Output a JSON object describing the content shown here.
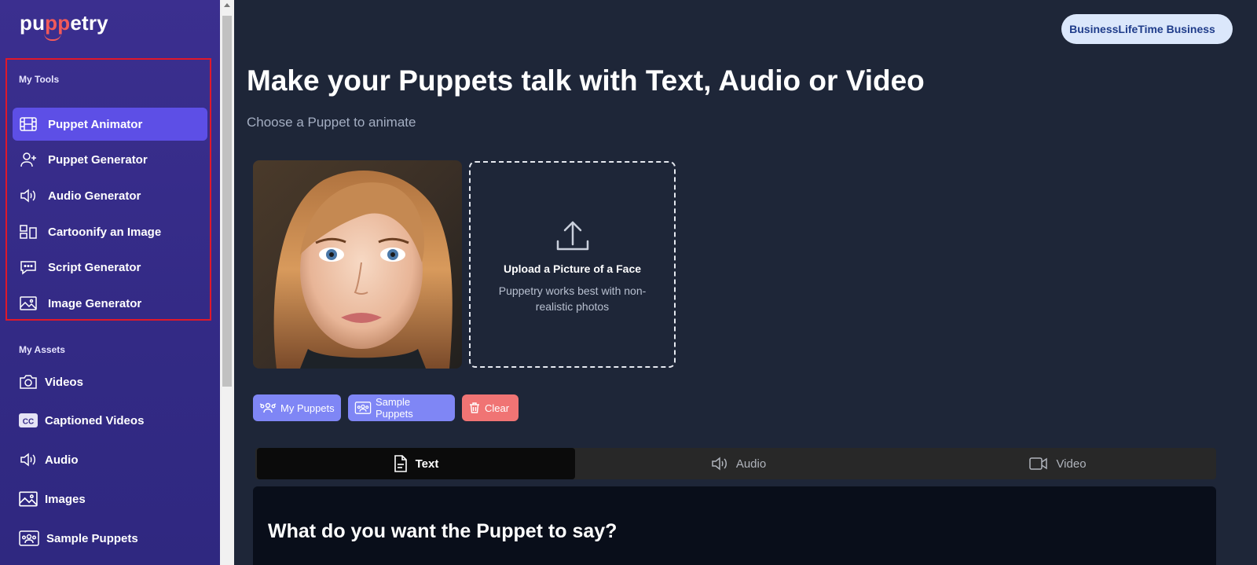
{
  "app": {
    "logo_text_a": "pu",
    "logo_text_b": "pp",
    "logo_text_c": "etry"
  },
  "sidebar": {
    "tools_title": "My Tools",
    "tools": [
      {
        "label": "Puppet Animator",
        "icon": "film-icon",
        "active": true
      },
      {
        "label": "Puppet Generator",
        "icon": "user-plus-icon"
      },
      {
        "label": "Audio Generator",
        "icon": "speaker-icon"
      },
      {
        "label": "Cartoonify an Image",
        "icon": "layout-icon"
      },
      {
        "label": "Script Generator",
        "icon": "chat-bubble-icon"
      },
      {
        "label": "Image Generator",
        "icon": "image-icon"
      }
    ],
    "assets_title": "My Assets",
    "assets": [
      {
        "label": "Videos",
        "icon": "camera-icon"
      },
      {
        "label": "Captioned Videos",
        "icon": "cc-icon"
      },
      {
        "label": "Audio",
        "icon": "speaker-icon"
      },
      {
        "label": "Images",
        "icon": "image-icon"
      },
      {
        "label": "Sample Puppets",
        "icon": "group-icon"
      }
    ]
  },
  "header": {
    "plan_label": "BusinessLifeTime Business"
  },
  "main": {
    "title": "Make your Puppets talk with Text, Audio or Video",
    "subtitle": "Choose a Puppet to animate",
    "upload": {
      "title": "Upload a Picture of a Face",
      "description": "Puppetry works best with non-realistic photos"
    },
    "chips": [
      {
        "label": "My Puppets",
        "color": "#7f86f5"
      },
      {
        "label": "Sample Puppets",
        "color": "#7f86f5"
      },
      {
        "label": "Clear",
        "color": "#f07474"
      }
    ],
    "tabs": [
      {
        "label": "Text",
        "icon": "document-icon",
        "active": true
      },
      {
        "label": "Audio",
        "icon": "speaker-icon"
      },
      {
        "label": "Video",
        "icon": "video-camera-icon"
      }
    ],
    "panel_title": "What do you want the Puppet to say?"
  },
  "colors": {
    "sidebar": "#352b88",
    "active_item": "#5d4fe6",
    "main_bg": "#1e2638",
    "highlight_border": "#e0182a"
  }
}
